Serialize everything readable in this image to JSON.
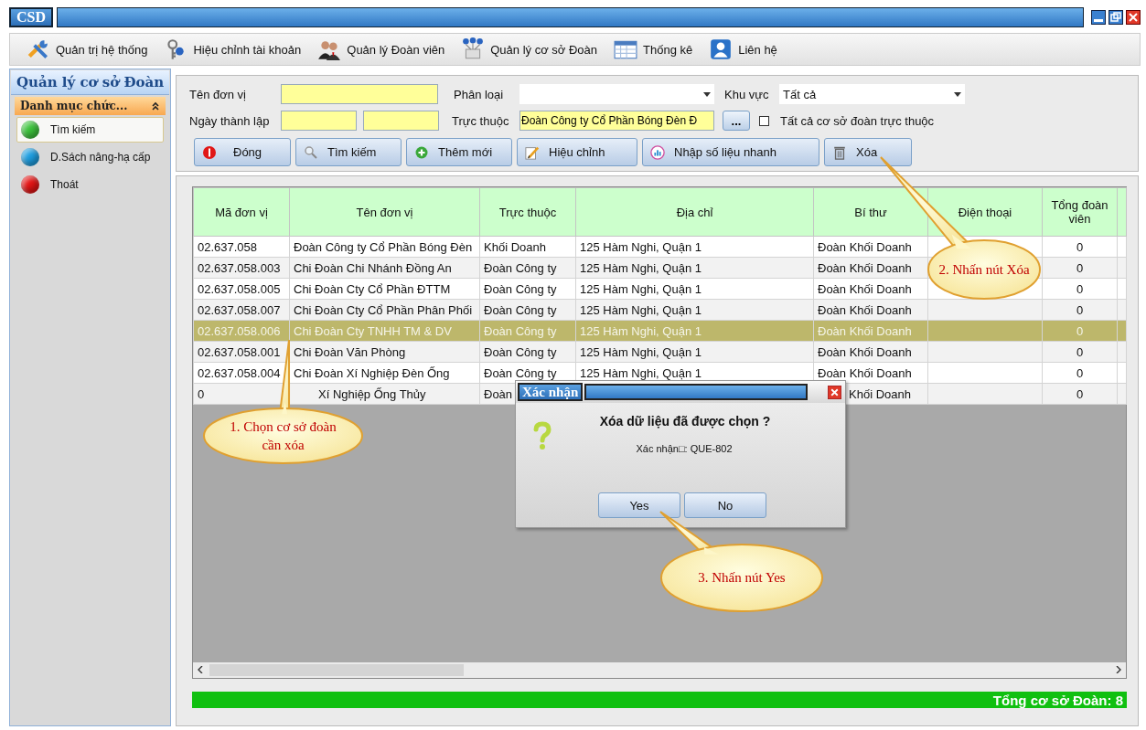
{
  "window": {
    "title": "CSD"
  },
  "toolbar": [
    {
      "label": "Quản trị hệ thống",
      "kind": "tools"
    },
    {
      "label": "Hiệu chỉnh tài khoản",
      "kind": "account"
    },
    {
      "label": "Quản lý Đoàn viên",
      "kind": "people"
    },
    {
      "label": "Quản lý cơ sở Đoàn",
      "kind": "network"
    },
    {
      "label": "Thống kê",
      "kind": "sheet"
    },
    {
      "label": "Liên hệ",
      "kind": "contact"
    }
  ],
  "sidebar": {
    "title": "Quản lý cơ sở Đoàn",
    "section": "Danh mục chức...",
    "items": [
      {
        "label": "Tìm kiếm",
        "color": "#3cc43c",
        "selected": true
      },
      {
        "label": "D.Sách nâng-hạ cấp",
        "color": "#1e9ee0",
        "selected": false
      },
      {
        "label": "Thoát",
        "color": "#e41414",
        "selected": false
      }
    ]
  },
  "filters": {
    "ten_don_vi": {
      "label": "Tên đơn vị"
    },
    "phan_loai": {
      "label": "Phân loại"
    },
    "khu_vuc": {
      "label": "Khu vực",
      "value": "Tất cả"
    },
    "ngay_thanh_lap": {
      "label": "Ngày thành lập"
    },
    "truc_thuoc": {
      "label": "Trực thuộc",
      "value": "Đoàn Công ty Cổ Phần Bóng Đèn Đ",
      "browse": "..."
    },
    "include_all": {
      "label": "Tất cả cơ sở đoàn trực thuộc",
      "checked": false
    }
  },
  "actions": [
    {
      "label": "Đóng",
      "kind": "close"
    },
    {
      "label": "Tìm kiếm",
      "kind": "search"
    },
    {
      "label": "Thêm mới",
      "kind": "add"
    },
    {
      "label": "Hiệu chỉnh",
      "kind": "edit"
    },
    {
      "label": "Nhập số liệu nhanh",
      "kind": "chart"
    },
    {
      "label": "Xóa",
      "kind": "delete"
    }
  ],
  "table": {
    "columns": [
      "Mã đơn vị",
      "Tên đơn vị",
      "Trực thuộc",
      "Địa chỉ",
      "Bí thư",
      "Điện thoại",
      "Tổng đoàn viên"
    ],
    "rows": [
      {
        "cells": [
          "02.637.058",
          "Đoàn Công ty Cổ Phần Bóng Đèn",
          "Khối Doanh",
          "125 Hàm Nghi, Quận 1",
          "Đoàn Khối Doanh",
          "",
          "0"
        ],
        "selected": false
      },
      {
        "cells": [
          "02.637.058.003",
          "Chi Đoàn Chi Nhánh Đồng An",
          "Đoàn Công ty",
          "125 Hàm Nghi, Quận 1",
          "Đoàn Khối Doanh",
          "",
          "0"
        ],
        "selected": false
      },
      {
        "cells": [
          "02.637.058.005",
          "Chi Đoàn Cty Cổ Phần ĐTTM",
          "Đoàn Công ty",
          "125 Hàm Nghi, Quận 1",
          "Đoàn Khối Doanh",
          "",
          "0"
        ],
        "selected": false
      },
      {
        "cells": [
          "02.637.058.007",
          "Chi Đoàn Cty Cổ Phần Phân Phối",
          "Đoàn Công ty",
          "125 Hàm Nghi, Quận 1",
          "Đoàn Khối Doanh",
          "",
          "0"
        ],
        "selected": false
      },
      {
        "cells": [
          "02.637.058.006",
          "Chi Đoàn Cty TNHH TM & DV",
          "Đoàn Công ty",
          "125 Hàm Nghi, Quận 1",
          "Đoàn Khối Doanh",
          "",
          "0"
        ],
        "selected": true
      },
      {
        "cells": [
          "02.637.058.001",
          "Chi Đoàn Văn Phòng",
          "Đoàn Công ty",
          "125 Hàm Nghi, Quận 1",
          "Đoàn Khối Doanh",
          "",
          "0"
        ],
        "selected": false
      },
      {
        "cells": [
          "02.637.058.004",
          "Chi Đoàn Xí Nghiệp Đèn Ống",
          "Đoàn Công ty",
          "125 Hàm Nghi, Quận 1",
          "Đoàn Khối Doanh",
          "",
          "0"
        ],
        "selected": false
      },
      {
        "cells": [
          "0",
          "Xí Nghiệp Ống Thủy",
          "Đoàn",
          "",
          "Khối Doanh",
          "",
          "0"
        ],
        "selected": false,
        "kind": "covered"
      }
    ]
  },
  "status_bar": {
    "total": "Tổng cơ sở Đoàn: 8"
  },
  "dialog": {
    "title": "Xác nhận",
    "message": "Xóa dữ liệu đã được chọn ?",
    "code": "Xác nhận□: QUE-802",
    "buttons": [
      "Yes",
      "No"
    ]
  },
  "callouts": [
    {
      "text": "1. Chọn cơ sở đoàn cần xóa"
    },
    {
      "text": "2. Nhấn nút Xóa"
    },
    {
      "text": "3. Nhấn nút Yes"
    }
  ]
}
